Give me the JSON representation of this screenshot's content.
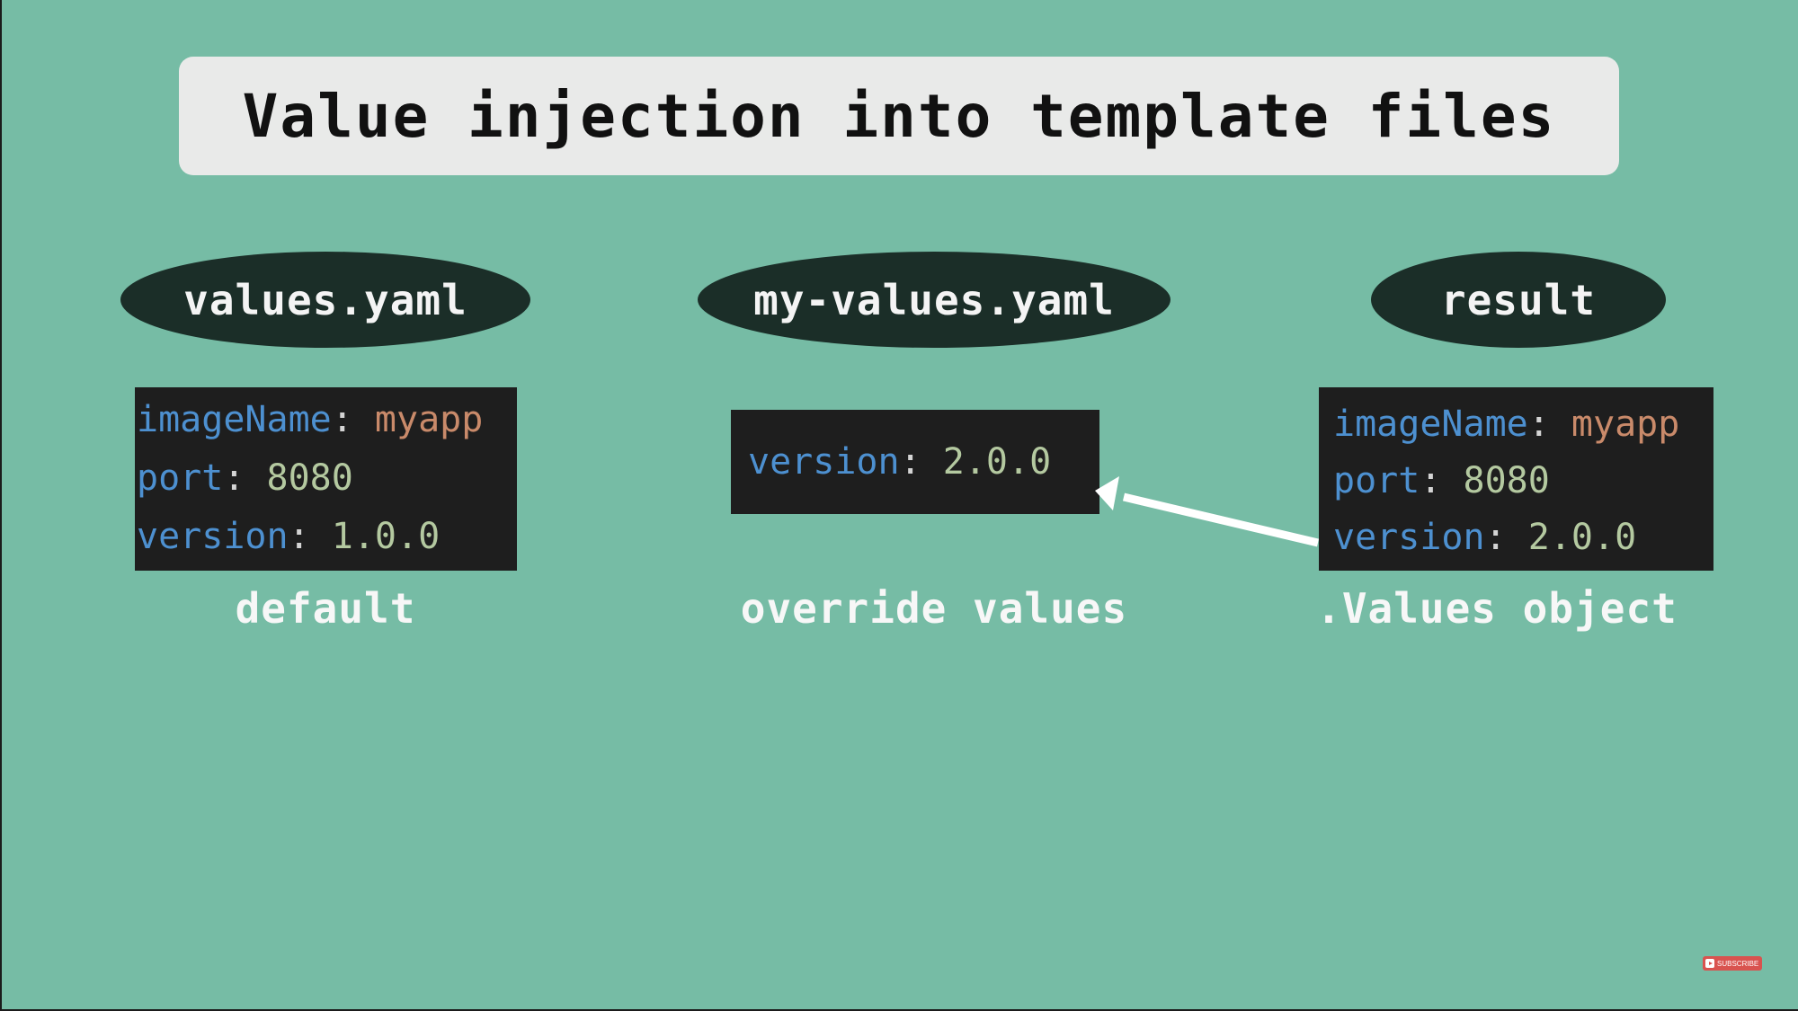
{
  "title": "Value injection into template files",
  "columns": [
    {
      "label": "values.yaml",
      "caption": "default",
      "lines": [
        {
          "key": "imageName",
          "sep": ": ",
          "value": "myapp",
          "type": "string"
        },
        {
          "key": "port",
          "sep": ": ",
          "value": "8080",
          "type": "number"
        },
        {
          "key": "version",
          "sep": ": ",
          "value": "1.0.0",
          "type": "number"
        }
      ]
    },
    {
      "label": "my-values.yaml",
      "caption": "override values",
      "lines": [
        {
          "key": "version",
          "sep": ": ",
          "value": "2.0.0",
          "type": "number"
        }
      ]
    },
    {
      "label": "result",
      "caption": ".Values object",
      "lines": [
        {
          "key": "imageName",
          "sep": ": ",
          "value": "myapp",
          "type": "string"
        },
        {
          "key": "port",
          "sep": ": ",
          "value": "8080",
          "type": "number"
        },
        {
          "key": "version",
          "sep": ": ",
          "value": "2.0.0",
          "type": "number"
        }
      ]
    }
  ],
  "arrow": {
    "from": "result",
    "to": "my-values.yaml",
    "color": "#ffffff"
  },
  "colors": {
    "background": "#76bca5",
    "title_box": "#e9eae9",
    "pill": "#1b2e28",
    "code_bg": "#1e1e1e",
    "code_key": "#4d90d0",
    "code_string": "#c98a6a",
    "code_number": "#b4c9a0"
  },
  "subscribe_badge": {
    "label": "SUBSCRIBE",
    "icon": "play-icon"
  }
}
